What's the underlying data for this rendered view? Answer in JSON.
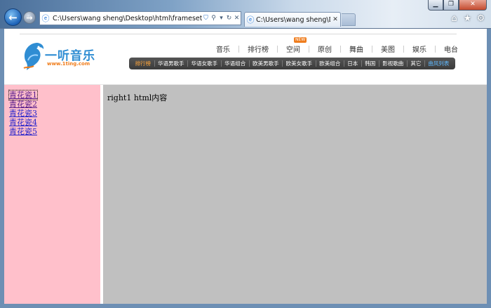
{
  "window": {
    "minimize_icon": "minimize-icon",
    "restore_icon": "restore-icon",
    "close_icon": "close-icon"
  },
  "toolbar": {
    "back_icon": "back-arrow-icon",
    "forward_icon": "forward-arrow-icon",
    "address": "C:\\Users\\wang sheng\\Desktop\\html\\frameset\\all.htm",
    "address_tools": [
      "shield",
      "search",
      "dropdown",
      "refresh",
      "stop"
    ],
    "home_icon": "home-icon",
    "favorites_icon": "star-icon",
    "settings_icon": "gear-icon"
  },
  "tab": {
    "title": "C:\\Users\\wang sheng\\De...",
    "close_label": "✕"
  },
  "site": {
    "logo_text": "一听音乐",
    "logo_sub": "www.1ting.com",
    "hot_badge": "NEW",
    "main_nav": [
      "音乐",
      "排行榜",
      "空间",
      "原创",
      "舞曲",
      "美图",
      "娱乐",
      "电台"
    ],
    "sub_nav": [
      "排行榜",
      "华语男歌手",
      "华语女歌手",
      "华语组合",
      "欧美男歌手",
      "欧美女歌手",
      "欧美组合",
      "日本",
      "韩国",
      "影视歌曲",
      "其它",
      "曲风列表"
    ],
    "accent_color": "#ef7d1e",
    "brand_color": "#2f8dd3"
  },
  "left": {
    "background": "#ffc0cb",
    "links": [
      "青花瓷1",
      "青花瓷2",
      "青花瓷3",
      "青花瓷4",
      "青花瓷5"
    ]
  },
  "right": {
    "background": "#c0c0c0",
    "content": "right1 html内容"
  }
}
